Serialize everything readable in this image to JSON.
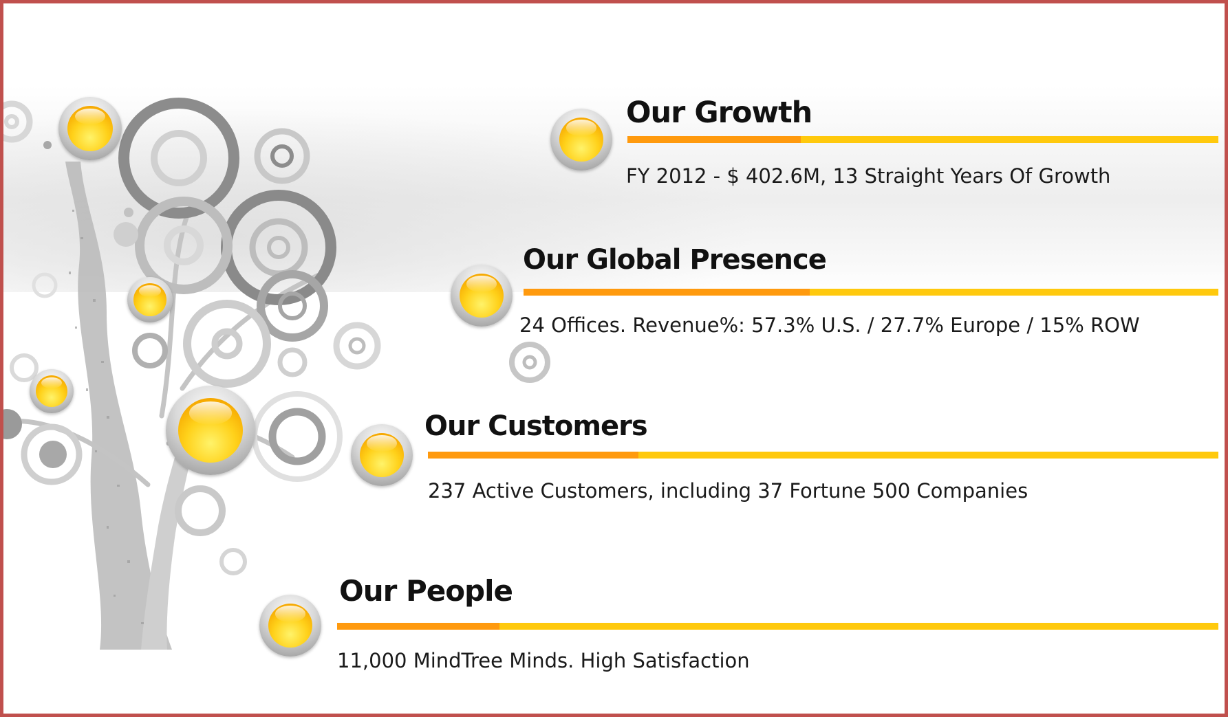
{
  "sections": [
    {
      "title": "Our  Growth",
      "description": "FY 2012 - $ 402.6M, 13 Straight Years Of Growth"
    },
    {
      "title": "Our Global Presence",
      "description": "24 Offices. Revenue%: 57.3% U.S.  / 27.7% Europe  / 15% ROW"
    },
    {
      "title": "Our Customers",
      "description": "237 Active Customers, including 37 Fortune 500 Companies"
    },
    {
      "title": "Our People",
      "description": "11,000  MindTree Minds. High Satisfaction"
    }
  ],
  "colors": {
    "border": "#c0504d",
    "bar_primary": "#ff9a0e",
    "bar_secondary": "#ffc90d",
    "orb": "#ffd11a"
  },
  "decoration": {
    "illustration": "abstract-tree-with-circles-icon",
    "bullet": "yellow-orb-icon"
  }
}
